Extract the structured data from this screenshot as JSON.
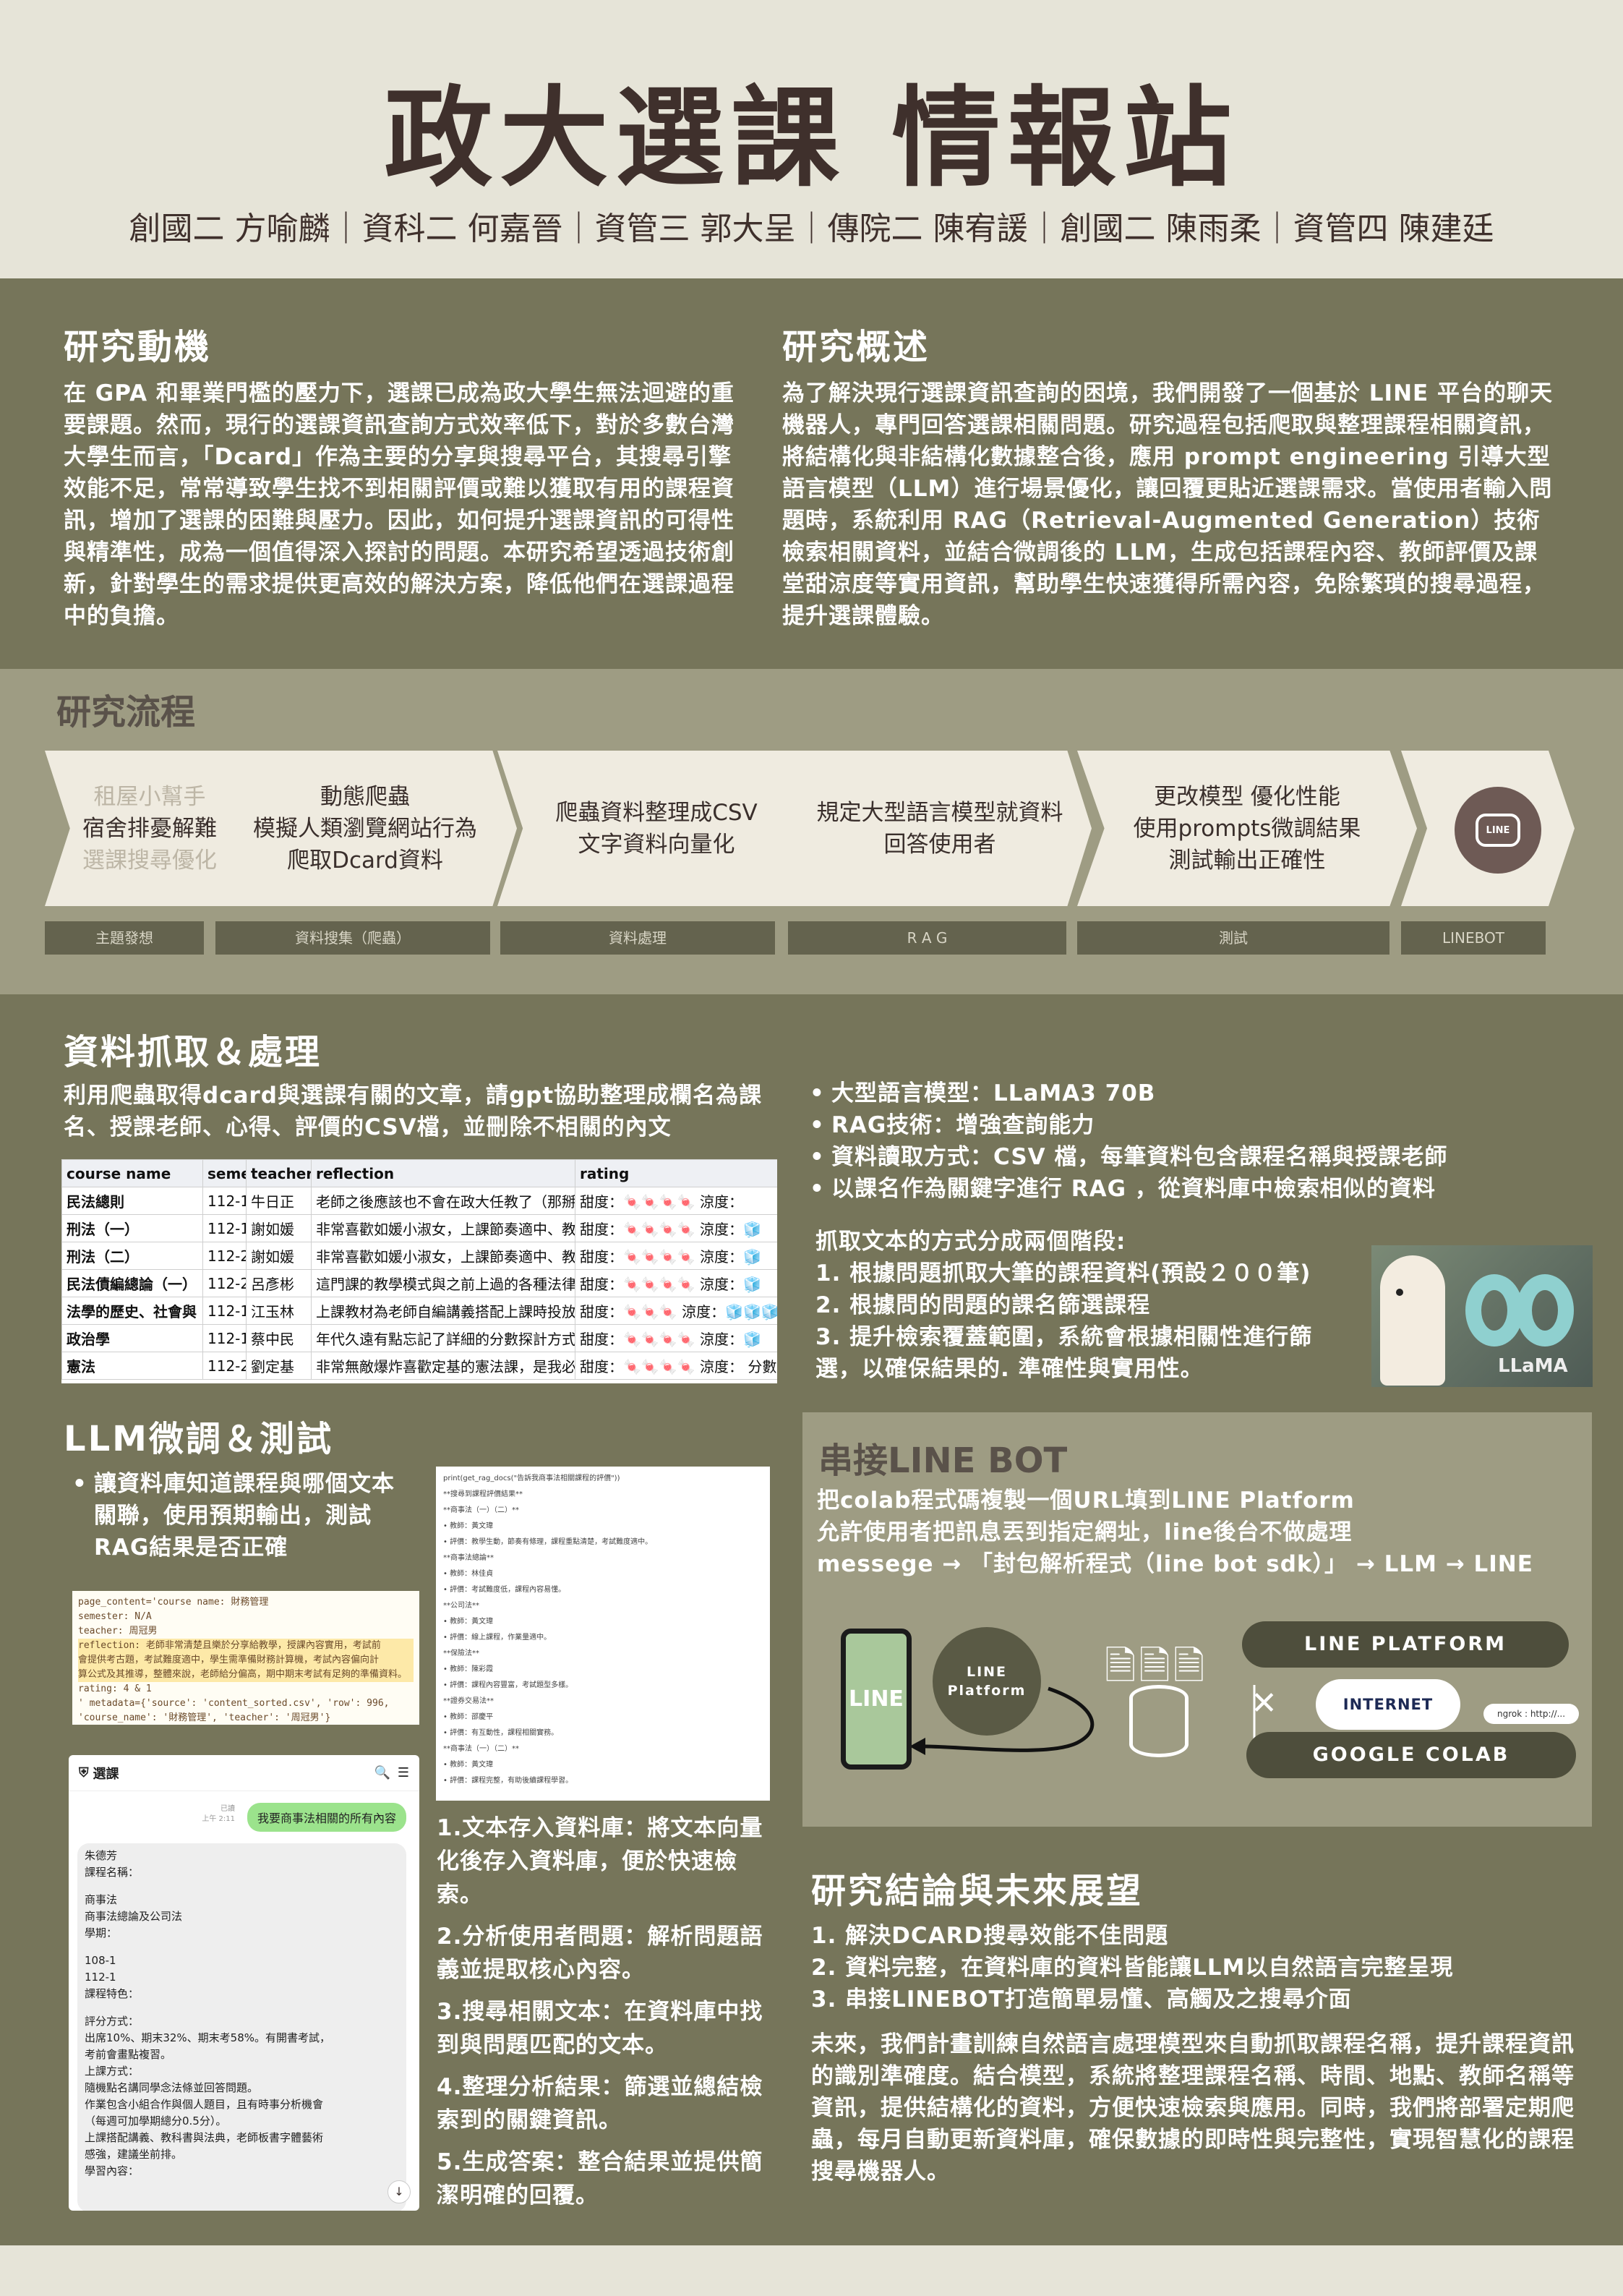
{
  "header": {
    "title": "政大選課 情報站",
    "authors": "創國二 方喻麟｜資科二 何嘉晉｜資管三 郭大呈｜傳院二 陳宥諼｜創國二 陳雨柔｜資管四 陳建廷"
  },
  "motivation": {
    "heading": "研究動機",
    "text": "在 GPA 和畢業門檻的壓力下，選課已成為政大學生無法迴避的重要課題。然而，現行的選課資訊查詢方式效率低下，對於多數台灣大學生而言，「Dcard」作為主要的分享與搜尋平台，其搜尋引擎效能不足，常常導致學生找不到相關評價或難以獲取有用的課程資訊，增加了選課的困難與壓力。因此，如何提升選課資訊的可得性與精準性，成為一個值得深入探討的問題。本研究希望透過技術創新，針對學生的需求提供更高效的解決方案，降低他們在選課過程中的負擔。"
  },
  "overview": {
    "heading": "研究概述",
    "text": "為了解決現行選課資訊查詢的困境，我們開發了一個基於 LINE 平台的聊天機器人，專門回答選課相關問題。研究過程包括爬取與整理課程相關資訊，將結構化與非結構化數據整合後，應用 prompt engineering 引導大型語言模型（LLM）進行場景優化，讓回覆更貼近選課需求。當使用者輸入問題時，系統利用 RAG（Retrieval-Augmented Generation）技術檢索相關資料，並結合微調後的 LLM，生成包括課程內容、教師評價及課堂甜涼度等實用資訊，幫助學生快速獲得所需內容，免除繁瑣的搜尋過程，提升選課體驗。"
  },
  "flow": {
    "heading": "研究流程",
    "steps": [
      {
        "l1": "租屋小幫手",
        "l2": "宿舍排憂解難",
        "l3": "選課搜尋優化",
        "tag": "主題發想"
      },
      {
        "l1": "動態爬蟲",
        "l2": "模擬人類瀏覽網站行為",
        "l3": "爬取Dcard資料",
        "tag": "資料搜集（爬蟲）"
      },
      {
        "l1": "爬蟲資料整理成CSV",
        "l2": "文字資料向量化",
        "l3": "",
        "tag": "資料處理"
      },
      {
        "l1": "規定大型語言模型就資料",
        "l2": "回答使用者",
        "l3": "",
        "tag": "R A G"
      },
      {
        "l1": "更改模型 優化性能",
        "l2": "使用prompts微調結果",
        "l3": "測試輸出正確性",
        "tag": "測試"
      },
      {
        "l1": "LINE",
        "l2": "",
        "l3": "",
        "tag": "LINEBOT"
      }
    ]
  },
  "data_section": {
    "heading": "資料抓取＆處理",
    "intro": "利用爬蟲取得dcard與選課有關的文章，請gpt協助整理成欄名為課名、授課老師、心得、評價的CSV檔，並刪除不相關的內文",
    "table": {
      "headers": [
        "course name",
        "semes",
        "teacher",
        "reflection",
        "rating"
      ],
      "rows": [
        [
          "民法總則",
          "112-1",
          "牛日正",
          "老師之後應該也不會在政大任教了（那掰",
          "甜度：🍬🍬🍬🍬 涼度："
        ],
        [
          "刑法（一）",
          "112-1",
          "謝如媛",
          "非常喜歡如媛小淑女，上課節奏適中、教",
          "甜度：🍬🍬🍬🍬 涼度：🧊"
        ],
        [
          "刑法（二）",
          "112-2",
          "謝如媛",
          "非常喜歡如媛小淑女，上課節奏適中、教",
          "甜度：🍬🍬🍬🍬 涼度：🧊"
        ],
        [
          "民法債編總論（一）",
          "112-2",
          "呂彥彬",
          "這門課的教學模式與之前上過的各種法律",
          "甜度：🍬🍬🍬🍬 涼度：🧊"
        ],
        [
          "法學的歷史、社會與",
          "112-1",
          "江玉林",
          "上課教材為老師自編講義搭配上課時投放",
          "甜度：🍬🍬🍬 涼度：🧊🧊🧊"
        ],
        [
          "政治學",
          "112-1",
          "蔡中民",
          "年代久遠有點忘記了詳細的分數探計方式",
          "甜度：🍬🍬🍬🍬 涼度：🧊"
        ],
        [
          "憲法",
          "112-2",
          "劉定基",
          "非常無敵爆炸喜歡定基的憲法課，是我必",
          "甜度：🍬🍬🍬🍬 涼度： 分數"
        ]
      ]
    },
    "bullets": [
      "大型語言模型：LLaMA3 70B",
      "RAG技術：增強查詢能力",
      "資料讀取方式：CSV 檔，每筆資料包含課程名稱與授課老師",
      "以課名作為關鍵字進行 RAG ，從資料庫中檢索相似的資料"
    ],
    "stages_title": "抓取文本的方式分成兩個階段:",
    "stages": [
      "1. 根據問題抓取大筆的課程資料(預設２００筆)",
      "2. 根據問的問題的課名篩選課程",
      "3. 提升檢索覆蓋範圍，系統會根據相關性進行篩選，以確保結果的. 準確性與實用性。"
    ],
    "llama_label": "LLaMA"
  },
  "llm_section": {
    "heading": "LLM微調＆測試",
    "bullet": "讓資料庫知道課程與哪個文本關聯，使用預期輸出，測試RAG結果是否正確",
    "code_lines": [
      "page_content='course name: 財務管理",
      "semester: N/A",
      "teacher: 周冠男",
      "reflection: 老師非常清楚且樂於分享給教學，授課內容實用，考試前",
      "會提供考古題，考試難度適中，學生需準備財務計算機，考試內容偏向計",
      "算公式及其推導，整體來說，老師給分偏高，期中期末考試有足夠的準備資料。",
      "rating: 4 & 1",
      "' metadata={'source': 'content_sorted.csv', 'row': 996,",
      "'course_name': '財務管理', 'teacher': '周冠男'}"
    ],
    "notebook_lines": [
      "print(get_rag_docs(\"告訴我商事法相關課程的評價\"))",
      "**搜尋到課程評價結果**",
      "**商事法（一）（二）**",
      "• 教師：黃文瑋",
      "• 評價：教學生動，節奏有條理，課程重點清楚，考試難度適中。",
      "**商事法總論**",
      "• 教師：林佳貞",
      "• 評價：考試難度低，課程內容易懂。",
      "**公司法**",
      "• 教師：黃文瑋",
      "• 評價：線上課程，作業量適中。",
      "**保險法**",
      "• 教師：陳彩霞",
      "• 評價：課程內容豐富，考試題型多樣。",
      "**證券交易法**",
      "• 教師：邵慶平",
      "• 評價：有互動性，課程相關實務。",
      "**商事法（一）（二）**",
      "• 教師：黃文瑋",
      "• 評價：課程完整，有助後續課程學習。"
    ],
    "chat": {
      "title": "選課",
      "read_label": "已讀",
      "time_label": "上午 2:11",
      "user_msg": "我要商事法相關的所有內容",
      "reply_lines": [
        "朱德芳",
        "課程名稱：",
        "",
        "商事法",
        "商事法總論及公司法",
        "學期：",
        "",
        "108-1",
        "112-1",
        "課程特色：",
        "",
        "評分方式：",
        "出席10%、期末32%、期末考58%。有開書考試，",
        "考前會畫點複習。",
        "上課方式：",
        "隨機點名講同學念法條並回答問題。",
        "作業包含小組合作與個人題目，且有時事分析機會",
        "（每週可加學期總分0.5分）。",
        "上課搭配講義、教科書與法典，老師板書字體藝術",
        "感強，建議坐前排。",
        "學習內容："
      ]
    },
    "steps": [
      "1.文本存入資料庫：將文本向量化後存入資料庫，便於快速檢索。",
      "2.分析使用者問題：解析問題語義並提取核心內容。",
      "3.搜尋相關文本：在資料庫中找到與問題匹配的文本。",
      "4.整理分析結果：篩選並總結檢索到的關鍵資訊。",
      "5.生成答案：整合結果並提供簡潔明確的回覆。"
    ]
  },
  "linebot_section": {
    "heading": "串接LINE BOT",
    "text": "把colab程式碼複製一個URL填到LINE Platform\n允許使用者把訊息丟到指定網址，line後台不做處理\nmessege → 「封包解析程式（line bot sdk）」 → LLM → LINE",
    "phone_label": "LINE",
    "platform_label_1": "LINE",
    "platform_label_2": "Platform",
    "line_platform": "LINE PLATFORM",
    "internet": "INTERNET",
    "google_colab": "GOOGLE COLAB",
    "ngrok": "ngrok : http://..."
  },
  "conclusion": {
    "heading": "研究結論與未來展望",
    "points": [
      "1. 解決DCARD搜尋效能不佳問題",
      "2. 資料完整，在資料庫的資料皆能讓LLM以自然語言完整呈現",
      "3. 串接LINEBOT打造簡單易懂、高觸及之搜尋介面"
    ],
    "future": "未來，我們計畫訓練自然語言處理模型來自動抓取課程名稱，提升課程資訊的識別準確度。結合模型，系統將整理課程名稱、時間、地點、教師名稱等資訊，提供結構化的資料，方便快速檢索與應用。同時，我們將部署定期爬蟲，每月自動更新資料庫，確保數據的即時性與完整性，實現智慧化的課程搜尋機器人。"
  },
  "colors": {
    "olive": "#76755a",
    "light_olive": "#9e9c83",
    "cream": "#e6e4d8",
    "dark_brown": "#3f302c"
  }
}
